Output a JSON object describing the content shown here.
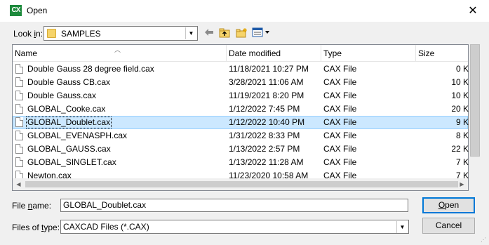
{
  "window": {
    "title": "Open",
    "app_icon": "CX",
    "close": "✕"
  },
  "lookin": {
    "label_prefix": "Look ",
    "label_underlined": "i",
    "label_suffix": "n:",
    "value": "SAMPLES"
  },
  "toolbar": {
    "back_icon": "back-arrow-icon",
    "up_icon": "up-folder-icon",
    "new_folder_icon": "new-folder-icon",
    "view_icon": "view-menu-icon"
  },
  "columns": {
    "name": "Name",
    "date": "Date modified",
    "type": "Type",
    "size": "Size"
  },
  "files": [
    {
      "name": "Double Gauss 28 degree field.cax",
      "date": "11/18/2021 10:27 PM",
      "type": "CAX File",
      "size": "0 K"
    },
    {
      "name": "Double Gauss CB.cax",
      "date": "3/28/2021 11:06 AM",
      "type": "CAX File",
      "size": "10 K"
    },
    {
      "name": "Double Gauss.cax",
      "date": "11/19/2021 8:20 PM",
      "type": "CAX File",
      "size": "10 K"
    },
    {
      "name": "GLOBAL_Cooke.cax",
      "date": "1/12/2022 7:45 PM",
      "type": "CAX File",
      "size": "20 K"
    },
    {
      "name": "GLOBAL_Doublet.cax",
      "date": "1/12/2022 10:40 PM",
      "type": "CAX File",
      "size": "9 K"
    },
    {
      "name": "GLOBAL_EVENASPH.cax",
      "date": "1/31/2022 8:33 PM",
      "type": "CAX File",
      "size": "8 K"
    },
    {
      "name": "GLOBAL_GAUSS.cax",
      "date": "1/13/2022 2:57 PM",
      "type": "CAX File",
      "size": "22 K"
    },
    {
      "name": "GLOBAL_SINGLET.cax",
      "date": "1/13/2022 11:28 AM",
      "type": "CAX File",
      "size": "7 K"
    },
    {
      "name": "Newton.cax",
      "date": "11/23/2020 10:58 AM",
      "type": "CAX File",
      "size": "7 K"
    }
  ],
  "selected_file_index": 4,
  "filename": {
    "label_prefix": "File ",
    "label_underlined": "n",
    "label_suffix": "ame:",
    "value": "GLOBAL_Doublet.cax"
  },
  "filetype": {
    "label_prefix": "Files of ",
    "label_underlined": "t",
    "label_suffix": "ype:",
    "value": "CAXCAD Files (*.CAX)"
  },
  "buttons": {
    "open_underlined": "O",
    "open_rest": "pen",
    "cancel": "Cancel"
  }
}
